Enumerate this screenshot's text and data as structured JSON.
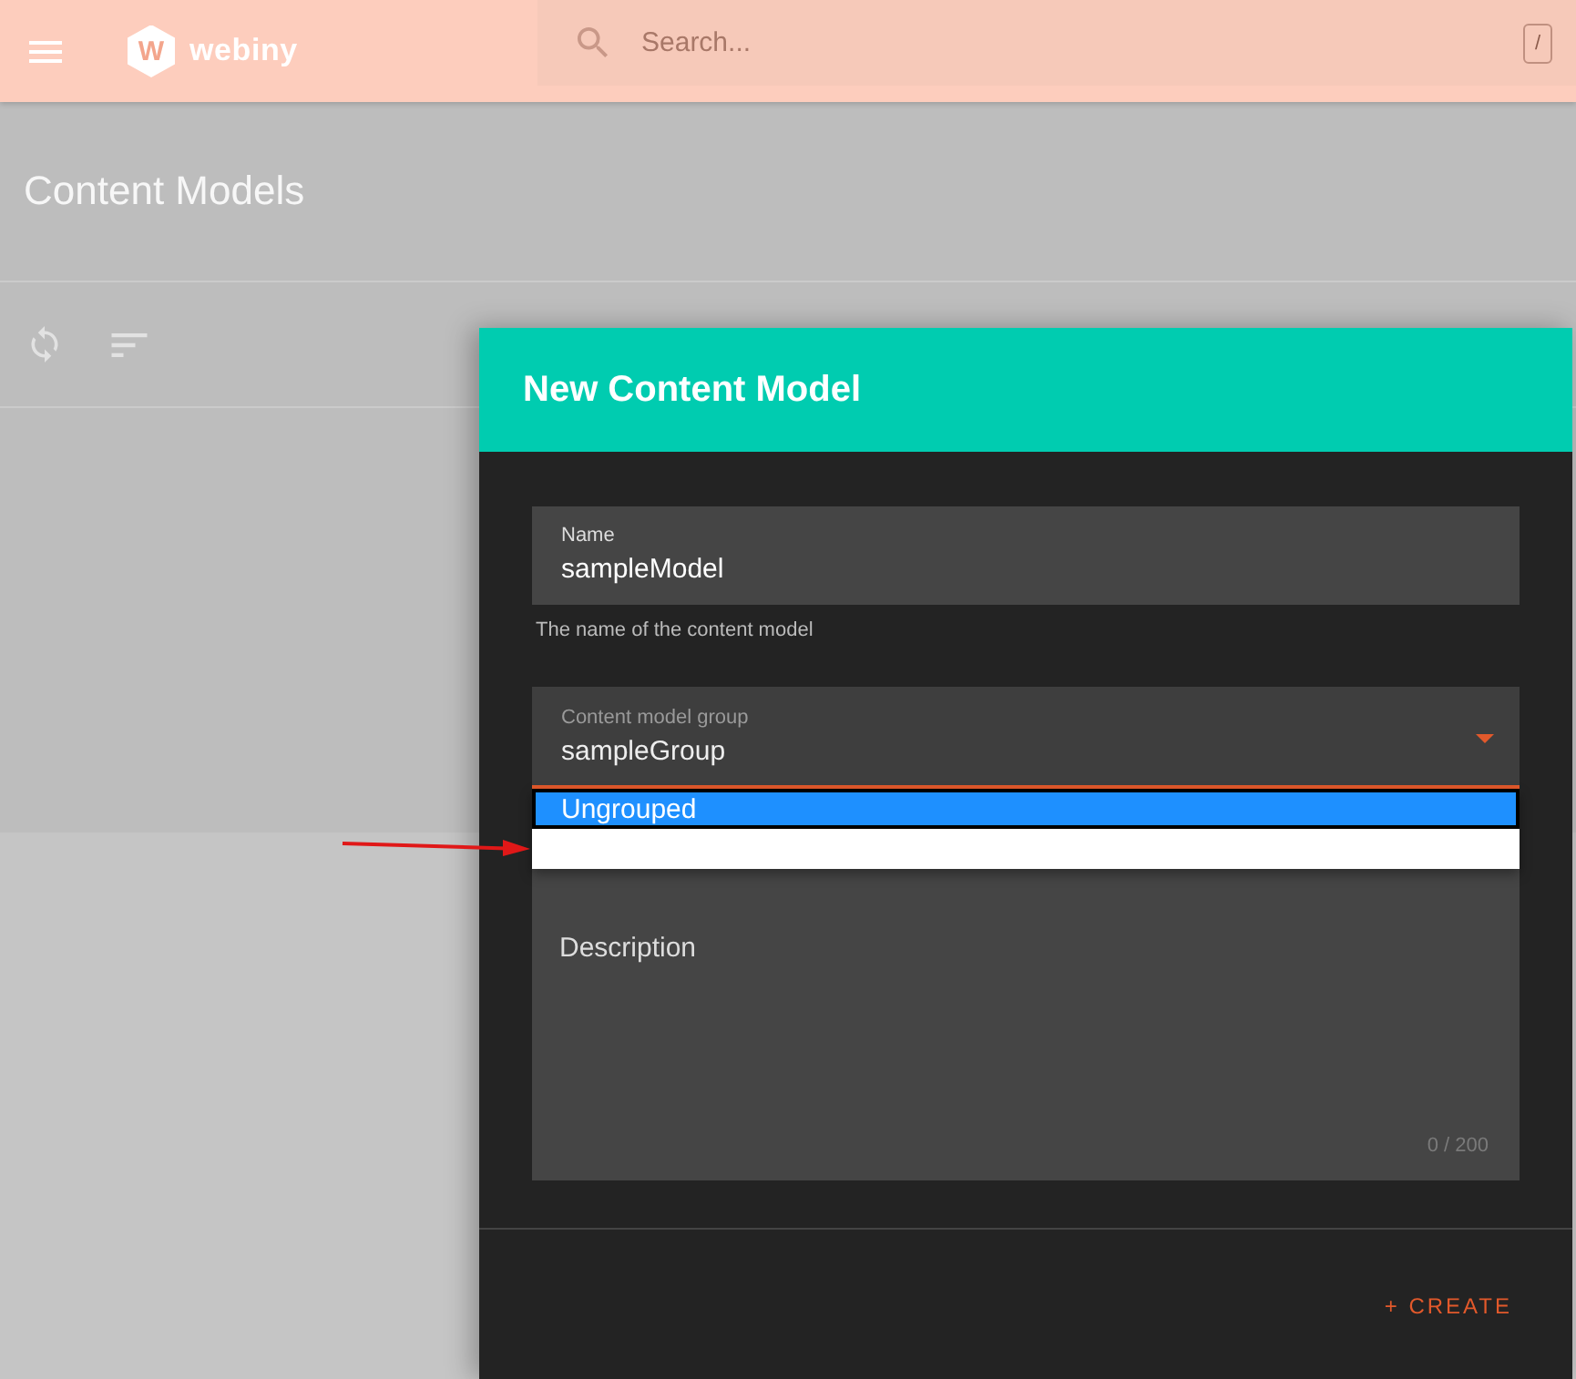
{
  "top_bar": {
    "logo": {
      "mark": "W",
      "text": "webiny"
    },
    "search": {
      "placeholder": "Search...",
      "shortcut": "/"
    }
  },
  "page": {
    "title": "Content Models"
  },
  "dialog": {
    "title": "New Content Model",
    "fields": [
      {
        "kind": "text",
        "label": "Name",
        "value": "sampleModel",
        "helper": "The name of the content model"
      },
      {
        "kind": "select",
        "label": "Content model group",
        "value": "sampleGroup",
        "expanded": true,
        "options": [
          {
            "label": "Ungrouped",
            "selected": true
          },
          {
            "selected": false
          }
        ]
      },
      {
        "kind": "textarea",
        "label": "Description",
        "counter": "0 / 200"
      }
    ],
    "actions": [
      {
        "label": "+ CREATE"
      }
    ]
  }
}
